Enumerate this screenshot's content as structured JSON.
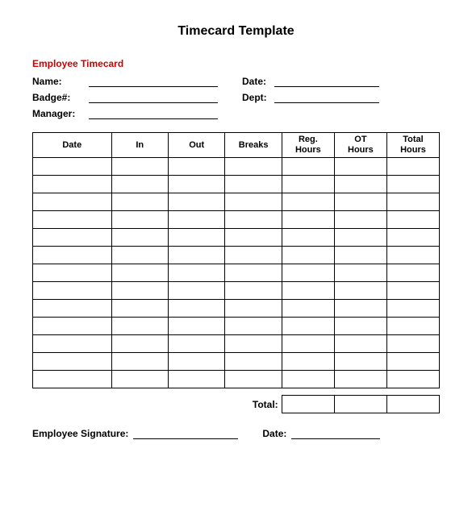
{
  "page": {
    "title": "Timecard Template",
    "employee_section_label": "Employee Timecard",
    "fields": {
      "name_label": "Name:",
      "date_label": "Date:",
      "badge_label": "Badge#:",
      "dept_label": "Dept:",
      "manager_label": "Manager:"
    },
    "table": {
      "headers": [
        "Date",
        "In",
        "Out",
        "Breaks",
        "Reg.\nHours",
        "OT\nHours",
        "Total\nHours"
      ],
      "header_date": "Date",
      "header_in": "In",
      "header_out": "Out",
      "header_breaks": "Breaks",
      "header_reg": "Reg. Hours",
      "header_ot": "OT Hours",
      "header_total": "Total Hours",
      "num_rows": 13,
      "total_label": "Total:"
    },
    "footer": {
      "signature_label": "Employee Signature:",
      "date_label": "Date:"
    }
  }
}
